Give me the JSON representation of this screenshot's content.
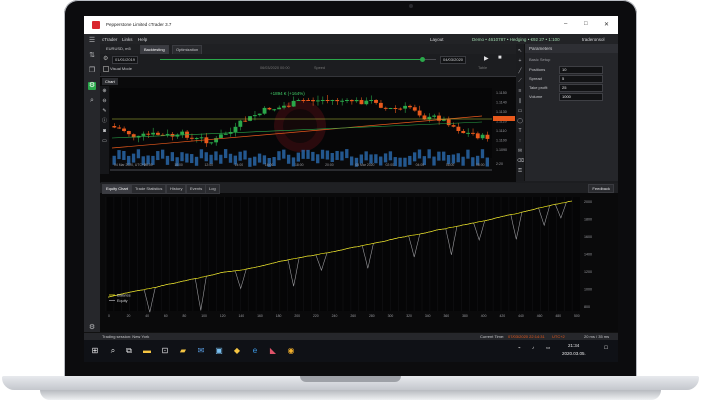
{
  "window": {
    "title": "Pepperstone Limited cTrader 3.7",
    "controls": [
      "–",
      "□",
      "✕"
    ]
  },
  "menubar": {
    "items": [
      "cTrader",
      "Links",
      "Help"
    ],
    "layout_label": "Layout",
    "account": "Demo • 4610787 • Hedging • €92 27 • 1:100",
    "user": "traderonsol"
  },
  "tabs": {
    "symbol": "EURUSD, m5",
    "backtesting": "Backtesting",
    "optimization": "Optimization"
  },
  "backtest": {
    "start_date": "01/01/2019",
    "end_date": "04/03/2020",
    "visual_mode": "Visual Mode",
    "current_time": "06/03/2020 00:00",
    "speed_label": "Speed",
    "table_label": "Table"
  },
  "chart": {
    "tab": "Chart",
    "overlay_text": "+1894 € (+164%)",
    "price_labels": [
      "1.1150",
      "1.1140",
      "1.1130",
      "1.1120",
      "1.1110",
      "1.1100",
      "1.1090"
    ],
    "time_labels": [
      "04 Mar 2020, UTC+2",
      "08:00",
      "10:00",
      "12:00",
      "14:00",
      "16:00",
      "18:00",
      "20:00",
      "05 Mar 2020",
      "02:00",
      "04:00",
      "06:00",
      "08:00"
    ],
    "axis_bracket": "2:20"
  },
  "equity": {
    "tabs": [
      "Equity Chart",
      "Trade Statistics",
      "History",
      "Events",
      "Log"
    ],
    "feedback": "Feedback",
    "legend": [
      "Balance",
      "Equity"
    ],
    "y_ticks": [
      "2000",
      "1800",
      "1600",
      "1400",
      "1200",
      "1000",
      "800"
    ],
    "x_ticks": [
      "0",
      "20",
      "40",
      "60",
      "80",
      "100",
      "120",
      "140",
      "160",
      "180",
      "200",
      "220",
      "240",
      "260",
      "280",
      "300",
      "320",
      "340",
      "360",
      "380",
      "400",
      "420",
      "440",
      "460",
      "480",
      "500"
    ]
  },
  "parameters": {
    "title": "Parameters",
    "section": "Basic Setup",
    "items": [
      {
        "label": "Positions",
        "value": "10"
      },
      {
        "label": "Spread",
        "value": "5"
      },
      {
        "label": "Take profit",
        "value": "25"
      },
      {
        "label": "Volume",
        "value": "1000"
      }
    ]
  },
  "status": {
    "session": "Trading session: New York",
    "current_time_label": "Current Time:",
    "current_time": "07/03/2020 22:14:31",
    "utc": "UTC+2",
    "ping": "20 ms / 35 ms"
  },
  "taskbar": {
    "time": "21:34",
    "date": "2020.03.05."
  },
  "colors": {
    "accent": "#2aa84a",
    "bull": "#2aa84a",
    "bear": "#e8591c",
    "balance": "#e8e01a",
    "equity": "#9a9a9e",
    "price_highlight": "#e8591c"
  }
}
